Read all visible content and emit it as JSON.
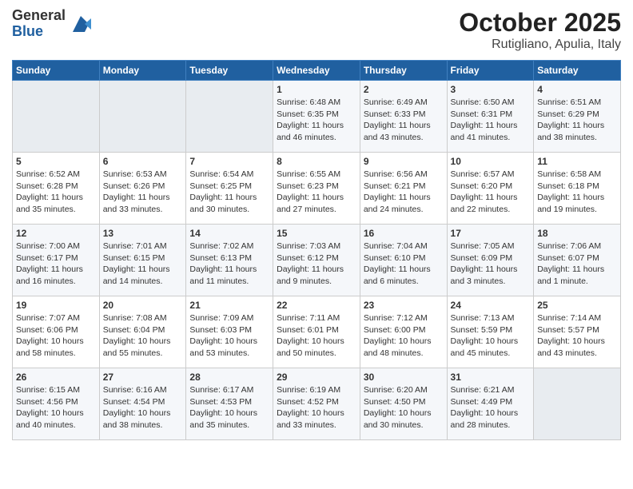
{
  "header": {
    "logo_general": "General",
    "logo_blue": "Blue",
    "month_year": "October 2025",
    "location": "Rutigliano, Apulia, Italy"
  },
  "days_of_week": [
    "Sunday",
    "Monday",
    "Tuesday",
    "Wednesday",
    "Thursday",
    "Friday",
    "Saturday"
  ],
  "weeks": [
    [
      {
        "day": "",
        "info": ""
      },
      {
        "day": "",
        "info": ""
      },
      {
        "day": "",
        "info": ""
      },
      {
        "day": "1",
        "info": "Sunrise: 6:48 AM\nSunset: 6:35 PM\nDaylight: 11 hours and 46 minutes."
      },
      {
        "day": "2",
        "info": "Sunrise: 6:49 AM\nSunset: 6:33 PM\nDaylight: 11 hours and 43 minutes."
      },
      {
        "day": "3",
        "info": "Sunrise: 6:50 AM\nSunset: 6:31 PM\nDaylight: 11 hours and 41 minutes."
      },
      {
        "day": "4",
        "info": "Sunrise: 6:51 AM\nSunset: 6:29 PM\nDaylight: 11 hours and 38 minutes."
      }
    ],
    [
      {
        "day": "5",
        "info": "Sunrise: 6:52 AM\nSunset: 6:28 PM\nDaylight: 11 hours and 35 minutes."
      },
      {
        "day": "6",
        "info": "Sunrise: 6:53 AM\nSunset: 6:26 PM\nDaylight: 11 hours and 33 minutes."
      },
      {
        "day": "7",
        "info": "Sunrise: 6:54 AM\nSunset: 6:25 PM\nDaylight: 11 hours and 30 minutes."
      },
      {
        "day": "8",
        "info": "Sunrise: 6:55 AM\nSunset: 6:23 PM\nDaylight: 11 hours and 27 minutes."
      },
      {
        "day": "9",
        "info": "Sunrise: 6:56 AM\nSunset: 6:21 PM\nDaylight: 11 hours and 24 minutes."
      },
      {
        "day": "10",
        "info": "Sunrise: 6:57 AM\nSunset: 6:20 PM\nDaylight: 11 hours and 22 minutes."
      },
      {
        "day": "11",
        "info": "Sunrise: 6:58 AM\nSunset: 6:18 PM\nDaylight: 11 hours and 19 minutes."
      }
    ],
    [
      {
        "day": "12",
        "info": "Sunrise: 7:00 AM\nSunset: 6:17 PM\nDaylight: 11 hours and 16 minutes."
      },
      {
        "day": "13",
        "info": "Sunrise: 7:01 AM\nSunset: 6:15 PM\nDaylight: 11 hours and 14 minutes."
      },
      {
        "day": "14",
        "info": "Sunrise: 7:02 AM\nSunset: 6:13 PM\nDaylight: 11 hours and 11 minutes."
      },
      {
        "day": "15",
        "info": "Sunrise: 7:03 AM\nSunset: 6:12 PM\nDaylight: 11 hours and 9 minutes."
      },
      {
        "day": "16",
        "info": "Sunrise: 7:04 AM\nSunset: 6:10 PM\nDaylight: 11 hours and 6 minutes."
      },
      {
        "day": "17",
        "info": "Sunrise: 7:05 AM\nSunset: 6:09 PM\nDaylight: 11 hours and 3 minutes."
      },
      {
        "day": "18",
        "info": "Sunrise: 7:06 AM\nSunset: 6:07 PM\nDaylight: 11 hours and 1 minute."
      }
    ],
    [
      {
        "day": "19",
        "info": "Sunrise: 7:07 AM\nSunset: 6:06 PM\nDaylight: 10 hours and 58 minutes."
      },
      {
        "day": "20",
        "info": "Sunrise: 7:08 AM\nSunset: 6:04 PM\nDaylight: 10 hours and 55 minutes."
      },
      {
        "day": "21",
        "info": "Sunrise: 7:09 AM\nSunset: 6:03 PM\nDaylight: 10 hours and 53 minutes."
      },
      {
        "day": "22",
        "info": "Sunrise: 7:11 AM\nSunset: 6:01 PM\nDaylight: 10 hours and 50 minutes."
      },
      {
        "day": "23",
        "info": "Sunrise: 7:12 AM\nSunset: 6:00 PM\nDaylight: 10 hours and 48 minutes."
      },
      {
        "day": "24",
        "info": "Sunrise: 7:13 AM\nSunset: 5:59 PM\nDaylight: 10 hours and 45 minutes."
      },
      {
        "day": "25",
        "info": "Sunrise: 7:14 AM\nSunset: 5:57 PM\nDaylight: 10 hours and 43 minutes."
      }
    ],
    [
      {
        "day": "26",
        "info": "Sunrise: 6:15 AM\nSunset: 4:56 PM\nDaylight: 10 hours and 40 minutes."
      },
      {
        "day": "27",
        "info": "Sunrise: 6:16 AM\nSunset: 4:54 PM\nDaylight: 10 hours and 38 minutes."
      },
      {
        "day": "28",
        "info": "Sunrise: 6:17 AM\nSunset: 4:53 PM\nDaylight: 10 hours and 35 minutes."
      },
      {
        "day": "29",
        "info": "Sunrise: 6:19 AM\nSunset: 4:52 PM\nDaylight: 10 hours and 33 minutes."
      },
      {
        "day": "30",
        "info": "Sunrise: 6:20 AM\nSunset: 4:50 PM\nDaylight: 10 hours and 30 minutes."
      },
      {
        "day": "31",
        "info": "Sunrise: 6:21 AM\nSunset: 4:49 PM\nDaylight: 10 hours and 28 minutes."
      },
      {
        "day": "",
        "info": ""
      }
    ]
  ]
}
